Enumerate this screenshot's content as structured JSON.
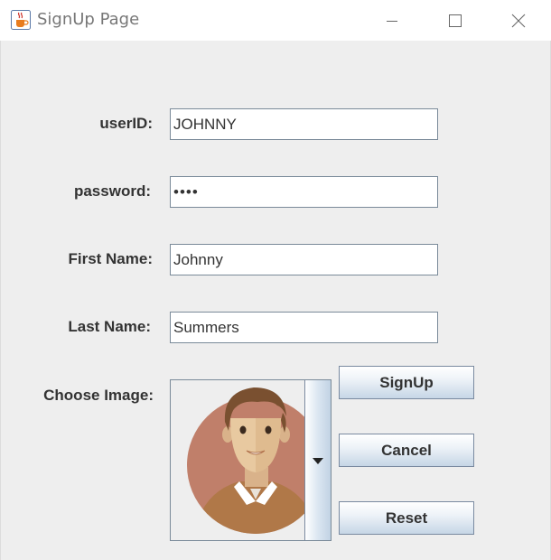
{
  "window": {
    "title": "SignUp Page",
    "icon": "java-cup-icon",
    "controls": [
      "minimize-icon",
      "maximize-icon",
      "close-icon"
    ]
  },
  "form": {
    "userid": {
      "label": "userID:",
      "value": "JOHNNY"
    },
    "password": {
      "label": "password:",
      "value": "••••"
    },
    "first_name": {
      "label": "First Name:",
      "value": "Johnny"
    },
    "last_name": {
      "label": "Last Name:",
      "value": "Summers"
    },
    "image": {
      "label": "Choose Image:",
      "selected": "male-avatar-icon"
    }
  },
  "buttons": {
    "signup": "SignUp",
    "cancel": "Cancel",
    "reset": "Reset"
  },
  "colors": {
    "avatar_bg": "#c07f6a",
    "shirt": "#b07848",
    "skin": "#e8c9a0",
    "hair": "#7a5030"
  }
}
